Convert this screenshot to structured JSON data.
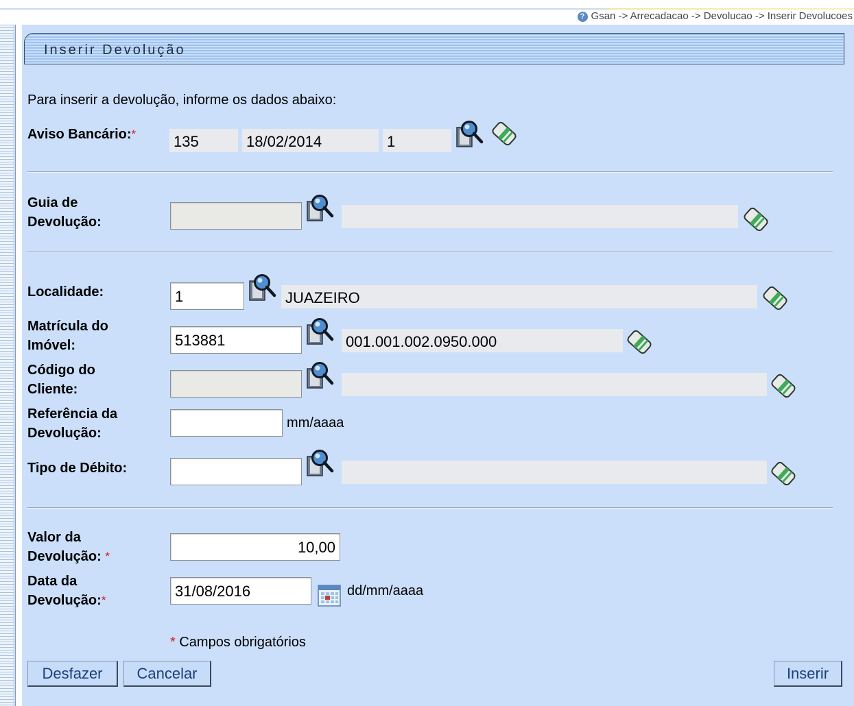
{
  "breadcrumb": "Gsan -> Arrecadacao -> Devolucao -> Inserir Devolucoes",
  "title": "Inserir Devolução",
  "instructions": "Para inserir a devolução, informe os dados abaixo:",
  "aviso": {
    "label": "Aviso Bancário:",
    "required_mark": "*",
    "code": "135",
    "date": "18/02/2014",
    "sequence": "1"
  },
  "guia": {
    "label_line1": "Guia de",
    "label_line2": "Devolução:",
    "value": "",
    "description": ""
  },
  "localidade": {
    "label": "Localidade:",
    "value": "1",
    "description": "JUAZEIRO"
  },
  "matricula": {
    "label_line1": "Matrícula do",
    "label_line2": "Imóvel:",
    "value": "513881",
    "description": "001.001.002.0950.000"
  },
  "cliente": {
    "label_line1": "Código do",
    "label_line2": "Cliente:",
    "value": "",
    "description": ""
  },
  "referencia": {
    "label_line1": "Referência da",
    "label_line2": "Devolução:",
    "value": "",
    "format_hint": "mm/aaaa"
  },
  "tipo_debito": {
    "label": "Tipo de Débito:",
    "value": "",
    "description": ""
  },
  "valor": {
    "label_line1": "Valor da",
    "label_line2": "Devolução:",
    "required_mark": "*",
    "value": "10,00"
  },
  "data": {
    "label_line1": "Data da",
    "label_line2": "Devolução:",
    "required_mark": "*",
    "value": "31/08/2016",
    "format_hint": "dd/mm/aaaa"
  },
  "required_note": {
    "mark": "*",
    "text": "Campos obrigatórios"
  },
  "buttons": {
    "undo": "Desfazer",
    "cancel": "Cancelar",
    "insert": "Inserir"
  },
  "colors": {
    "panel_bg": "#cbdffa",
    "required": "#d01a1a",
    "button_text": "#1b3f7a"
  }
}
